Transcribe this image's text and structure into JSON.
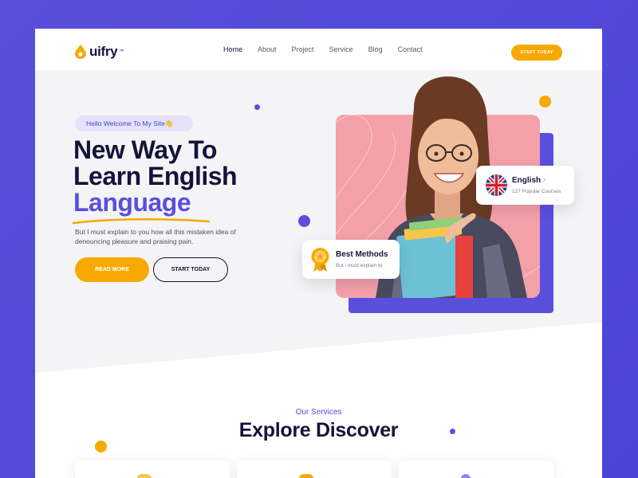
{
  "brand": {
    "name": "uifry",
    "tm": "™",
    "accent": "#f7a900",
    "primary": "#5a4fdc",
    "dark": "#15133a"
  },
  "nav": {
    "items": [
      "Home",
      "About",
      "Project",
      "Service",
      "Blog",
      "Contact"
    ],
    "active": "Home",
    "cta": "START TODAY"
  },
  "hero": {
    "badge": "Hello Welcome To My Site👋",
    "title_line1": "New Way To",
    "title_line2": "Learn English",
    "title_highlight": "Language",
    "description": "But I must explain to you how all this mistaken idea of denouncing pleasure and praising pain.",
    "btn_primary": "READ MORE",
    "btn_secondary": "START TODAY"
  },
  "cards": {
    "english": {
      "title": "English",
      "subtitle": "127 Popular Courses",
      "icon": "uk-flag-icon",
      "arrow": "›"
    },
    "best": {
      "title": "Best Methods",
      "subtitle": "But i must explain to",
      "icon": "medal-icon"
    }
  },
  "services": {
    "label": "Our Services",
    "title": "Explore Discover"
  }
}
